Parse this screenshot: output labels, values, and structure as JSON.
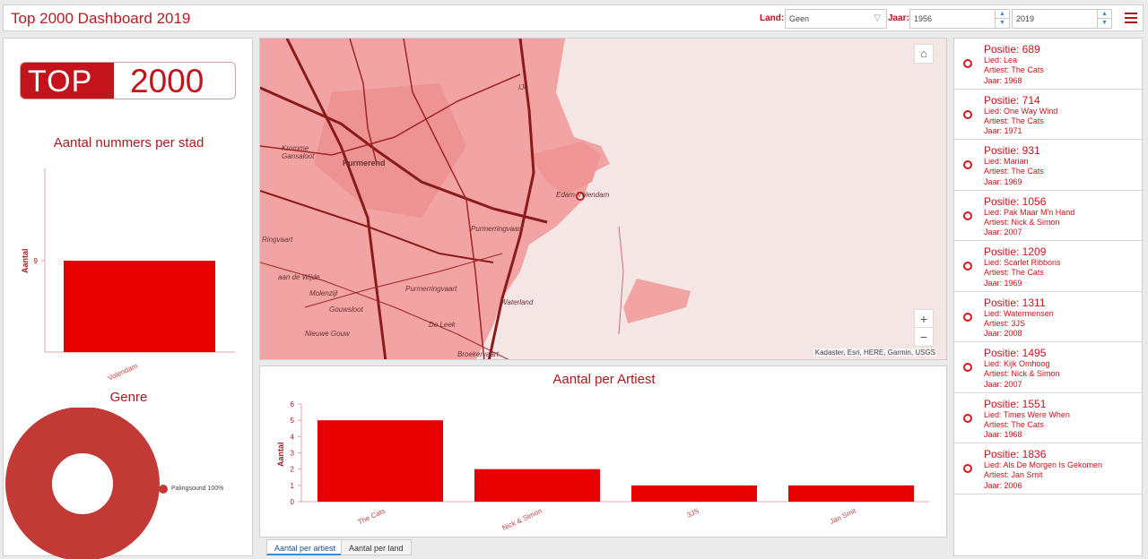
{
  "header": {
    "title": "Top 2000 Dashboard 2019",
    "land_label": "Land:",
    "land_value": "Geen",
    "jaar_label": "Jaar:",
    "jaar_from": "1956",
    "jaar_to": "2019"
  },
  "logo": {
    "part1": "TOP",
    "part2": "2000"
  },
  "city_chart": {
    "title": "Aantal nummers per stad",
    "ylabel": "Aantal",
    "categories": [
      "Volendam"
    ],
    "values": [
      9
    ],
    "tick_label": "9"
  },
  "genre_chart": {
    "title": "Genre",
    "legend_label": "Palingsound",
    "legend_value": "100%",
    "color": "#c13a35"
  },
  "map": {
    "attribution": "Kadaster, Esri, HERE, Garmin, USGS",
    "places": [
      "IJe",
      "Kromme Gansaloot",
      "Purmerend",
      "Edam-Volendam",
      "Purmerringvaart",
      "Ringvaart",
      "Molenzijl",
      "Gouwsloot",
      "De Leek",
      "Waterland",
      "Nieuwe Gouw",
      "Purmerringvaart",
      "Broekervaart",
      "aan de Wijde"
    ],
    "zoom_in": "+",
    "zoom_out": "−",
    "home_icon": "home-icon"
  },
  "chart_data": {
    "type": "bar",
    "title": "Aantal per Artiest",
    "ylabel": "Aantal",
    "categories": [
      "The Cats",
      "Nick & Simon",
      "3JS",
      "Jan Smit"
    ],
    "values": [
      5,
      2,
      1,
      1
    ],
    "ylim": [
      0,
      6
    ],
    "yticks": [
      "0",
      "1",
      "2",
      "3",
      "4",
      "5",
      "6"
    ],
    "color": "#e60000"
  },
  "tabs": [
    "Aantal per artiest",
    "Aantal per land"
  ],
  "songs": [
    {
      "pos": "Positie: 689",
      "lied": "Lied: Lea",
      "artiest": "Artiest: The Cats",
      "jaar": "Jaar: 1968"
    },
    {
      "pos": "Positie: 714",
      "lied": "Lied: One Way Wind",
      "artiest": "Artiest: The Cats",
      "jaar": "Jaar: 1971"
    },
    {
      "pos": "Positie: 931",
      "lied": "Lied: Marian",
      "artiest": "Artiest: The Cats",
      "jaar": "Jaar: 1969"
    },
    {
      "pos": "Positie: 1056",
      "lied": "Lied: Pak Maar M'n Hand",
      "artiest": "Artiest: Nick & Simon",
      "jaar": "Jaar: 2007"
    },
    {
      "pos": "Positie: 1209",
      "lied": "Lied: Scarlet Ribbons",
      "artiest": "Artiest: The Cats",
      "jaar": "Jaar: 1969"
    },
    {
      "pos": "Positie: 1311",
      "lied": "Lied: Watermensen",
      "artiest": "Artiest: 3JS",
      "jaar": "Jaar: 2008"
    },
    {
      "pos": "Positie: 1495",
      "lied": "Lied: Kijk Omhoog",
      "artiest": "Artiest: Nick & Simon",
      "jaar": "Jaar: 2007"
    },
    {
      "pos": "Positie: 1551",
      "lied": "Lied: Times Were When",
      "artiest": "Artiest: The Cats",
      "jaar": "Jaar: 1968"
    },
    {
      "pos": "Positie: 1836",
      "lied": "Lied: Als De Morgen Is Gekomen",
      "artiest": "Artiest: Jan Smit",
      "jaar": "Jaar: 2006"
    }
  ]
}
